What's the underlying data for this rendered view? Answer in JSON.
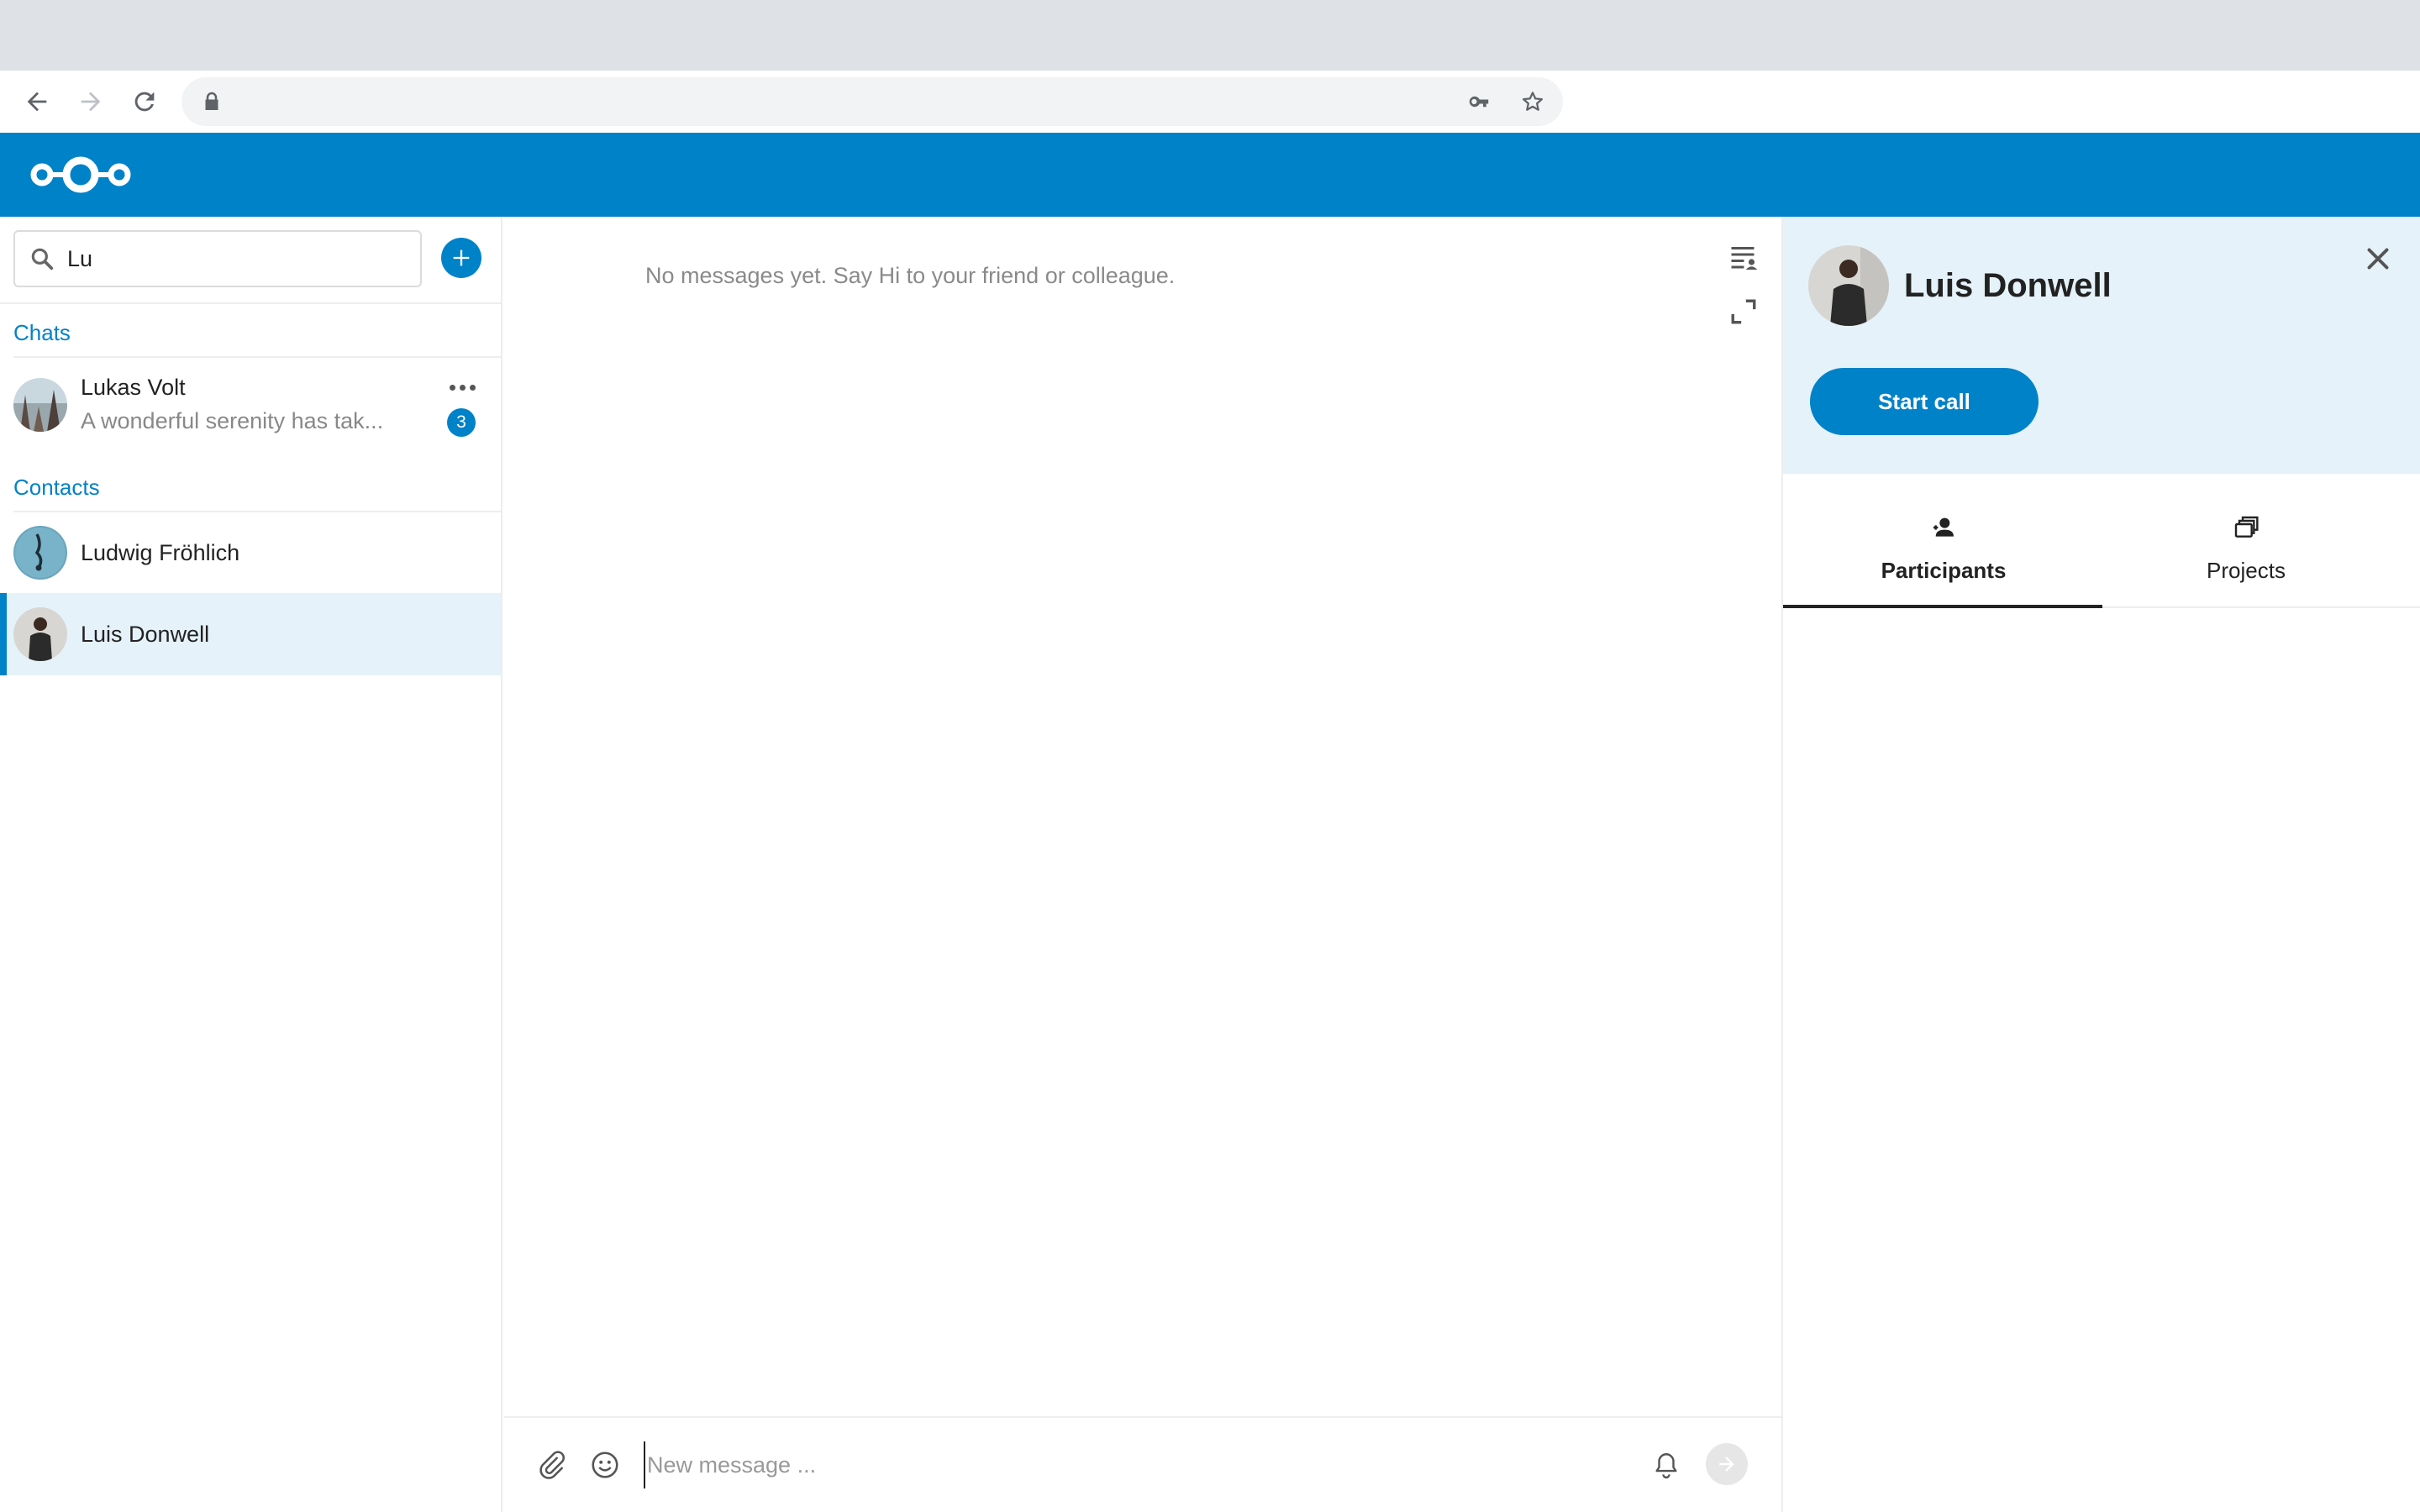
{
  "browser": {
    "address": ""
  },
  "left_nav": {
    "search": {
      "value": "Lu"
    },
    "sections": {
      "chats_caption": "Chats",
      "contacts_caption": "Contacts"
    },
    "chats": [
      {
        "name": "Lukas Volt",
        "preview": "A wonderful serenity has tak...",
        "unread": "3"
      }
    ],
    "contacts": [
      {
        "name": "Ludwig Fröhlich",
        "selected": false
      },
      {
        "name": "Luis Donwell",
        "selected": true
      }
    ]
  },
  "chat": {
    "empty_message": "No messages yet. Say Hi to your friend or colleague.",
    "input": {
      "placeholder": "New message ..."
    }
  },
  "sidebar": {
    "title": "Luis Donwell",
    "start_call_label": "Start call",
    "tabs": [
      {
        "label": "Participants",
        "icon": "participants-icon",
        "active": true
      },
      {
        "label": "Projects",
        "icon": "projects-icon",
        "active": false
      }
    ]
  },
  "colors": {
    "brand": "#0082c9",
    "selected_bg": "#e5f2fa",
    "muted_text": "#8a8a8a"
  }
}
